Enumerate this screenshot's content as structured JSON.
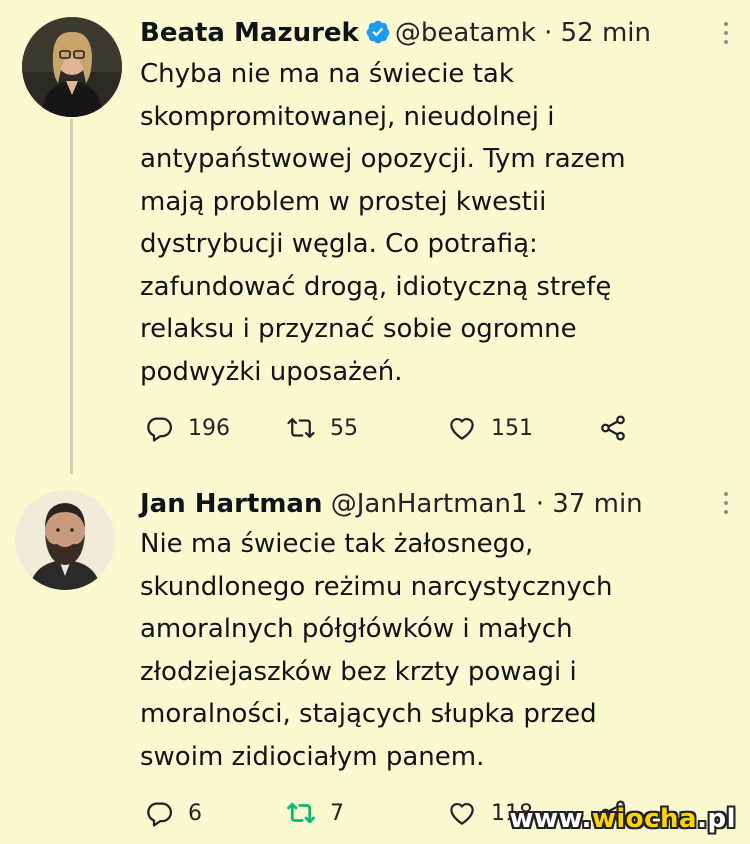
{
  "tweets": [
    {
      "name": "Beata Mazurek",
      "handle": "@beatamk",
      "dot": "·",
      "time": "52 min",
      "text": "Chyba nie ma na świecie tak\nskompromitowanej, nieudolnej i\nantypaństwowej opozycji. Tym razem\nmają problem w prostej kwestii\ndystrybucji węgla. Co potrafią:\nzafundować drogą, idiotyczną strefę\nrelaksu i przyznać sobie ogromne\npodwyżki uposażeń.",
      "replies": "196",
      "retweets": "55",
      "likes": "151"
    },
    {
      "name": "Jan Hartman",
      "handle": "@JanHartman1",
      "dot": "·",
      "time": "37 min",
      "text": "Nie ma świecie tak żałosnego,\nskundlonego reżimu narcystycznych\namoralnych półgłówków i małych\nzłodziejaszków bez krzty powagi i\nmoralności, stających słupka przed\nswoim zidiociałym panem.",
      "replies": "6",
      "retweets": "7",
      "likes": "118"
    }
  ],
  "watermark": {
    "prefix": "www.",
    "brand": "wiocha",
    "suffix": ".pl"
  },
  "colors": {
    "background": "#fbf9d0",
    "verified": "#1d9bf0",
    "retweet_active": "#00ba7c",
    "icon": "#1f2328"
  }
}
